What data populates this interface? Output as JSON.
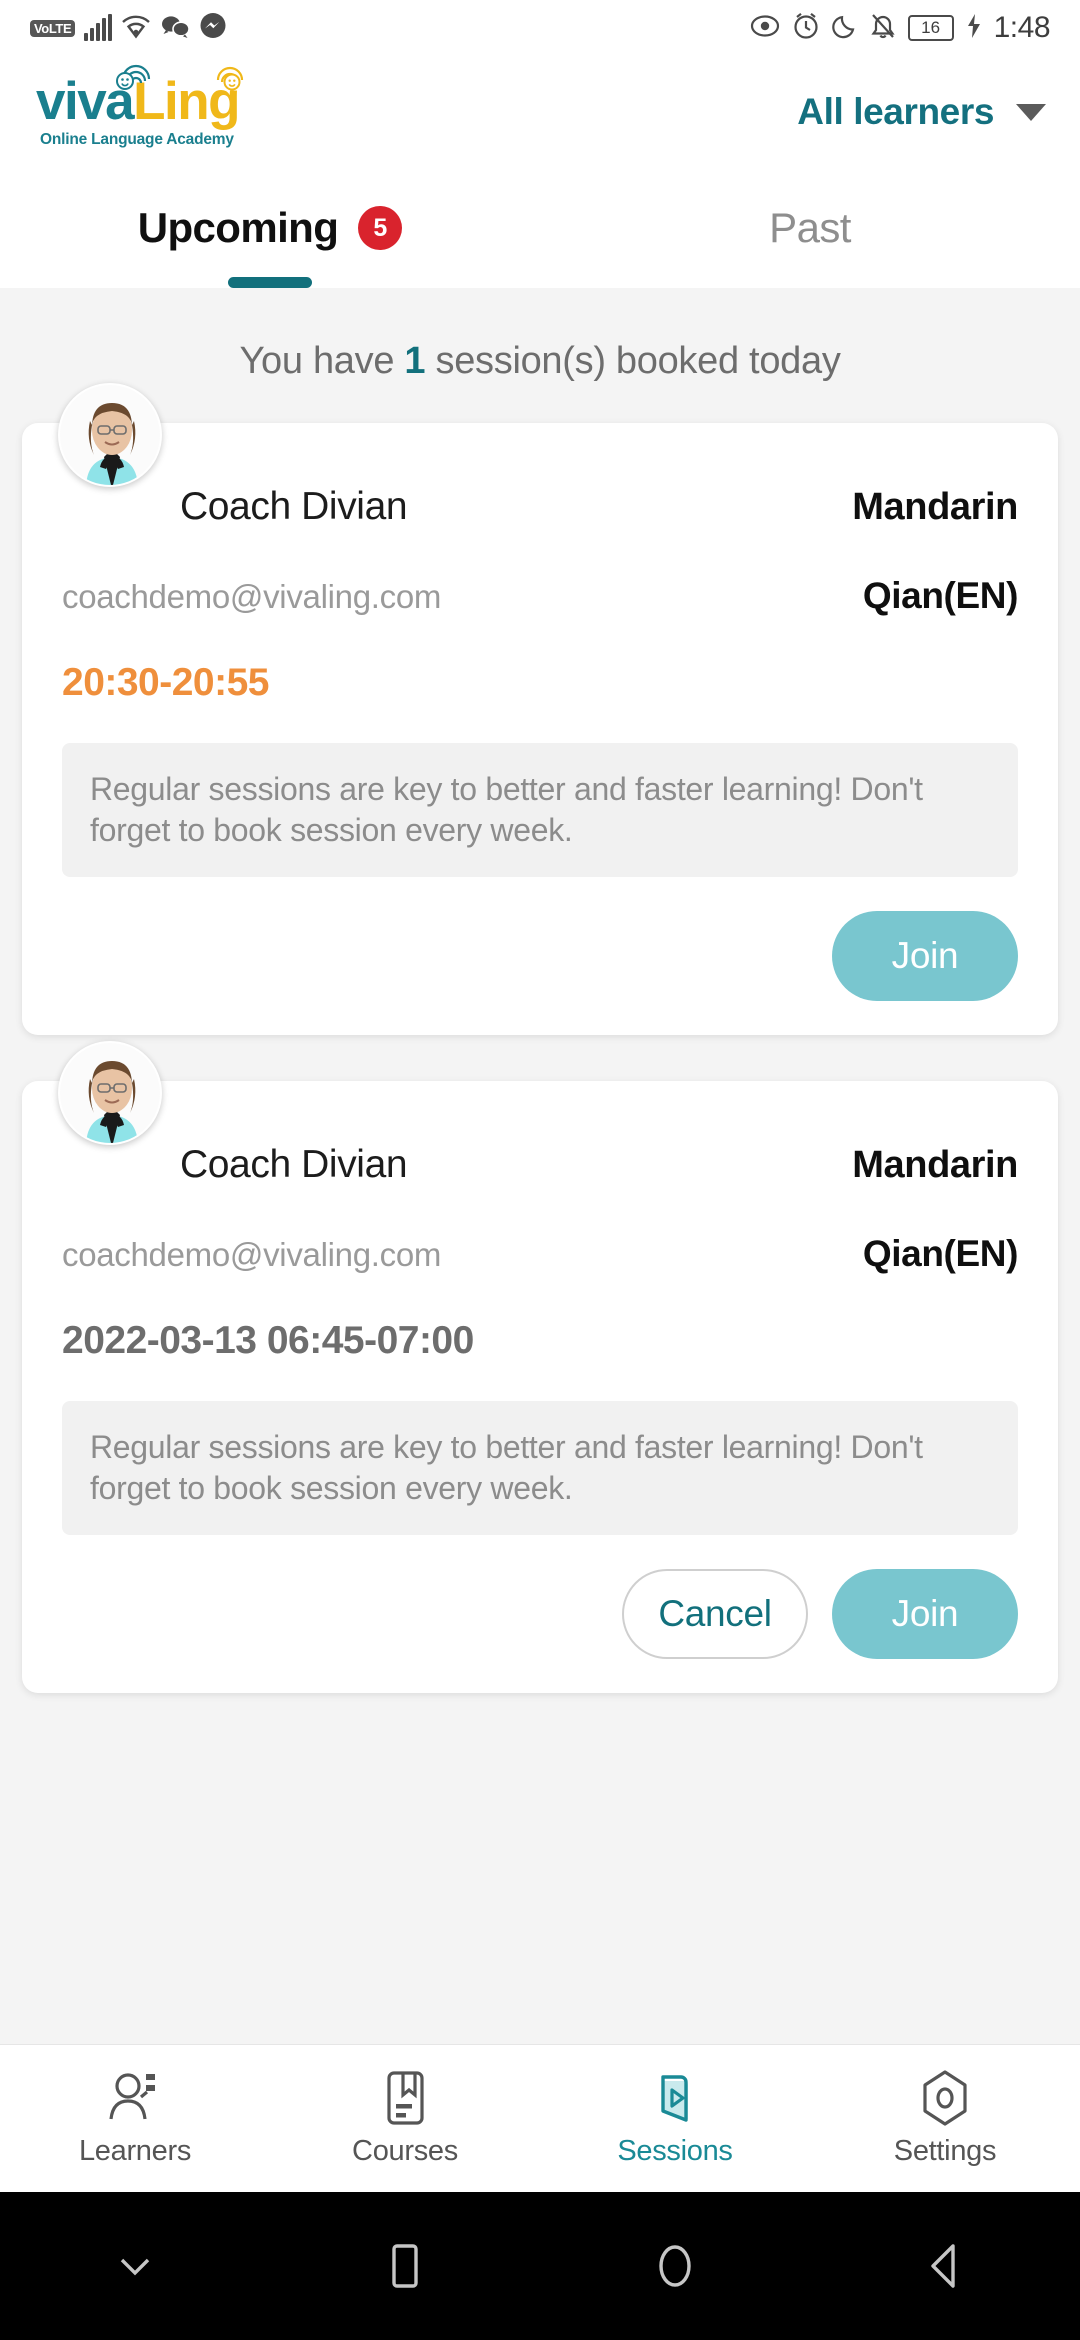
{
  "status_bar": {
    "volte": "VoLTE",
    "time": "1:48",
    "battery": "16",
    "icons": [
      "signal-icon",
      "wifi-icon",
      "wechat-icon",
      "messenger-icon",
      "eye-icon",
      "alarm-icon",
      "moon-icon",
      "mute-icon",
      "battery-icon",
      "charging-icon"
    ]
  },
  "header": {
    "logo_primary": "viva",
    "logo_secondary": "Ling",
    "logo_tagline": "Online Language Academy",
    "learner_filter": "All learners"
  },
  "tabs": [
    {
      "label": "Upcoming",
      "badge": "5",
      "active": true
    },
    {
      "label": "Past",
      "badge": "",
      "active": false
    }
  ],
  "booked_banner": {
    "prefix": "You have ",
    "count": "1",
    "suffix": " session(s) booked today"
  },
  "sessions": [
    {
      "coach": "Coach Divian",
      "language": "Mandarin",
      "email": "coachdemo@vivaling.com",
      "learner": "Qian(EN)",
      "time": "20:30-20:55",
      "time_style": "today",
      "note": "Regular sessions are key to better and faster learning! Don't forget to book session every week.",
      "cancel_label": "",
      "join_label": "Join"
    },
    {
      "coach": "Coach Divian",
      "language": "Mandarin",
      "email": "coachdemo@vivaling.com",
      "learner": "Qian(EN)",
      "time": "2022-03-13 06:45-07:00",
      "time_style": "future",
      "note": "Regular sessions are key to better and faster learning! Don't forget to book session every week.",
      "cancel_label": "Cancel",
      "join_label": "Join"
    }
  ],
  "bottom_nav": [
    {
      "label": "Learners",
      "icon": "learners-icon",
      "active": false
    },
    {
      "label": "Courses",
      "icon": "courses-icon",
      "active": false
    },
    {
      "label": "Sessions",
      "icon": "sessions-icon",
      "active": true
    },
    {
      "label": "Settings",
      "icon": "settings-icon",
      "active": false
    }
  ],
  "system_nav": [
    "hide-keyboard-icon",
    "recents-icon",
    "home-icon",
    "back-icon"
  ],
  "colors": {
    "teal": "#12707c",
    "yellow": "#f0b819",
    "orange": "#ef8f3c",
    "badge_red": "#d9232d",
    "join_button": "#79c6cf"
  }
}
